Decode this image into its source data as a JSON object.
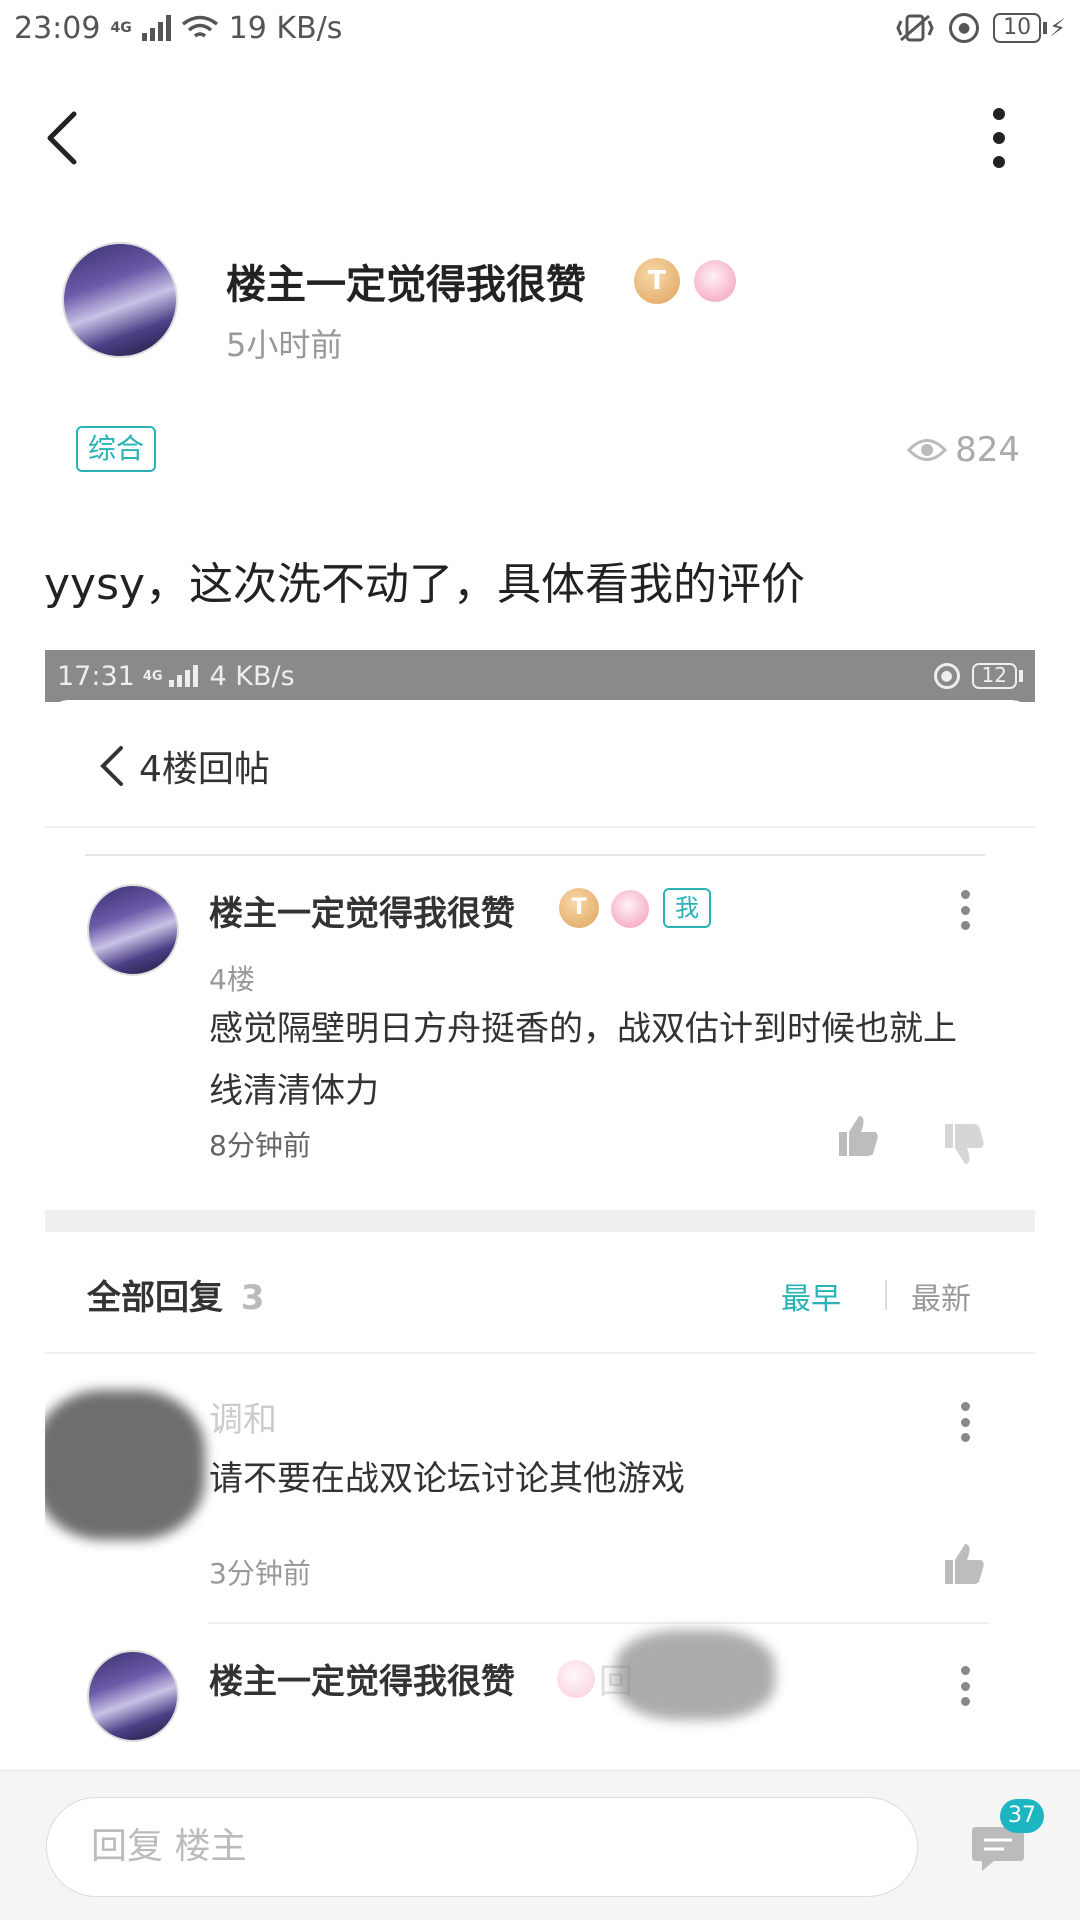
{
  "status_bar": {
    "time": "23:09",
    "network": "4G",
    "speed": "19 KB/s",
    "battery": "10"
  },
  "post": {
    "author": "楼主一定觉得我很赞",
    "level_badge": "T",
    "time": "5小时前",
    "tag": "综合",
    "views": "824",
    "text": "yysy，这次洗不动了，具体看我的评价"
  },
  "embedded": {
    "status_bar": {
      "time": "17:31",
      "network": "4G",
      "speed": "4 KB/s",
      "battery": "12"
    },
    "title": "4楼回帖",
    "reply": {
      "author": "楼主一定觉得我很赞",
      "level_badge": "T",
      "me_tag": "我",
      "floor": "4楼",
      "text": "感觉隔壁明日方舟挺香的，战双估计到时候也就上线清清体力",
      "time": "8分钟前"
    },
    "all_replies_label": "全部回复",
    "all_replies_count": "3",
    "sort_earliest": "最早",
    "sort_newest": "最新",
    "comment1": {
      "author": "调和",
      "text": "请不要在战双论坛讨论其他游戏",
      "time": "3分钟前"
    },
    "comment2": {
      "author": "楼主一定觉得我很赞",
      "text_prefix": "回"
    }
  },
  "bottom": {
    "reply_placeholder": "回复  楼主",
    "comment_count": "37"
  },
  "colors": {
    "accent": "#2ab3b5",
    "badge": "#1cb5c2"
  }
}
